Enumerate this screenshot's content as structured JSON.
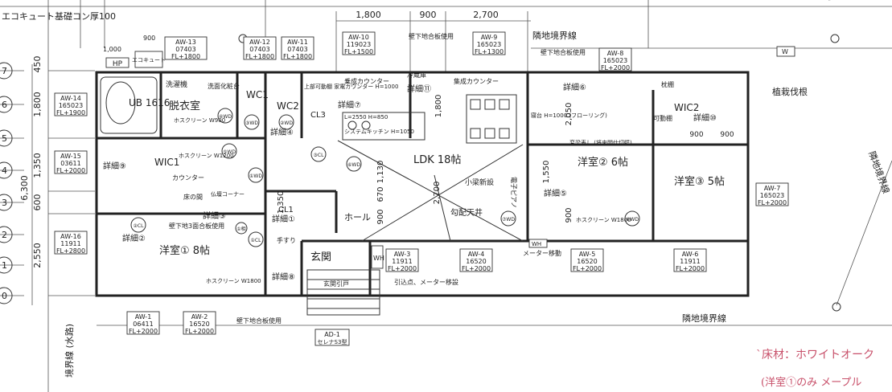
{
  "top_dims": [
    "1,800",
    "900",
    "2,700"
  ],
  "left_dims": [
    "450",
    "1,800",
    "1,350",
    "600",
    "2,550",
    "6,300"
  ],
  "left_axis": [
    "7",
    "6",
    "5",
    "4",
    "3",
    "2",
    "1",
    "0"
  ],
  "header_note": "エコキュート基礎コン厚100",
  "sub_dims": [
    "1,000",
    "900"
  ],
  "windows": [
    {
      "id": "AW-13",
      "w": "07403",
      "fl": "FL+1800"
    },
    {
      "id": "AW-12",
      "w": "07403",
      "fl": "FL+1800"
    },
    {
      "id": "AW-11",
      "w": "07403",
      "fl": "FL+1800"
    },
    {
      "id": "AW-10",
      "w": "119023",
      "fl": "FL+1500"
    },
    {
      "id": "AW-9",
      "w": "165023",
      "fl": "FL+1300"
    },
    {
      "id": "AW-8",
      "w": "165023",
      "fl": "FL+2000"
    },
    {
      "id": "AW-14",
      "w": "165023",
      "fl": "FL+1900"
    },
    {
      "id": "AW-15",
      "w": "03611",
      "fl": "FL+2000"
    },
    {
      "id": "AW-16",
      "w": "11911",
      "fl": "FL+2800"
    },
    {
      "id": "AW-7",
      "w": "165023",
      "fl": "FL+2000"
    },
    {
      "id": "AW-3",
      "w": "11911",
      "fl": "FL+2000"
    },
    {
      "id": "AW-4",
      "w": "16520",
      "fl": "FL+2000"
    },
    {
      "id": "AW-5",
      "w": "16520",
      "fl": "FL+2000"
    },
    {
      "id": "AW-6",
      "w": "11911",
      "fl": "FL+2000"
    },
    {
      "id": "AW-1",
      "w": "06411",
      "fl": "FL+2000"
    },
    {
      "id": "AW-2",
      "w": "16520",
      "fl": "FL+2000"
    },
    {
      "id": "AD-1",
      "w": "セレナS3型",
      "fl": ""
    }
  ],
  "rooms": {
    "ub": "UB\n1616",
    "datsui": "脱衣室",
    "wc1": "WC1",
    "wc2": "WC2",
    "wic1": "WIC1",
    "wic2": "WIC2",
    "ldk": "LDK 18帖",
    "yoshitsu1": "洋室① 8帖",
    "yoshitsu2": "洋室② 6帖",
    "yoshitsu3": "洋室③ 5帖",
    "genkan": "玄関",
    "hall": "ホール",
    "cl1": "CL1",
    "cl3": "CL3"
  },
  "labels": {
    "hp": "HP",
    "ecocute": "エコキュート",
    "sentakuki": "洗濯機",
    "senmen": "洗面化粧台",
    "reizouko": "冷蔵庫",
    "tanadai": "枕棚",
    "kadoudana": "可動棚",
    "counter": "カウンター",
    "tokonoma": "床の間",
    "butsudan": "仏壇コーナー",
    "koubai": "勾配天井",
    "shoumo": "小梁新設",
    "genkan_hiki": "玄関引戸",
    "hikikomi": "引込点、メーター移設",
    "meter": "メーター移動",
    "kabeshita_top": "壁下地合板使用",
    "kabeshita_top2": "壁下地合板使用",
    "kabeshita_bottom": "壁下地合板使用",
    "kabeshita3": "壁下地3面合板使用",
    "wh1": "WH",
    "wh2": "WH",
    "w_sq": "W",
    "hosukuri1": "ホスクリーン W900",
    "hosukuri2": "ホスクリーン W1200",
    "hosukuri3": "ホスクリーン W1800",
    "hosukuri4": "ホスクリーン W1800",
    "kitchen": "L=2550 H=850",
    "kitchen2": "システムキッチン H=1050",
    "nagashi": "乗成カウンター",
    "nagashi2": "集成カウンター",
    "shindai": "寝台 H=1000 (フローリング)",
    "kaisuu": "変梁表し (将来間仕切壁)",
    "pillar": "電子ピアノ",
    "detail": [
      "詳細①",
      "詳細②",
      "詳細③",
      "詳細④",
      "詳細⑤",
      "詳細⑥",
      "詳細⑦",
      "詳細⑧",
      "詳細⑨",
      "詳細⑩",
      "詳細⑪"
    ],
    "bound_top": "隣地境界線",
    "bound_bottom": "隣地境界線",
    "bound_left": "境界線 (水路)",
    "bound_right": "隣地境界線",
    "plant": "植栽伐根",
    "dims_ldk": [
      "1,800",
      "2,050",
      "1,550",
      "1,350",
      "1,130",
      "2,700",
      "670",
      "900",
      "900",
      "900",
      "900"
    ],
    "tesuri": "手すり",
    "kamiki": "上部可動棚 家電カウンター H=1000"
  },
  "handwritten": [
    "`床材：ホワイトオーク",
    "(洋室①のみ メープル"
  ],
  "wd_labels": [
    "④WD",
    "③WD",
    "②WD",
    "⑤WD",
    "⑥WD",
    "①WD",
    "⑦WD",
    "⑧WD",
    "②CL",
    "③CL",
    "①CL",
    "①相"
  ]
}
